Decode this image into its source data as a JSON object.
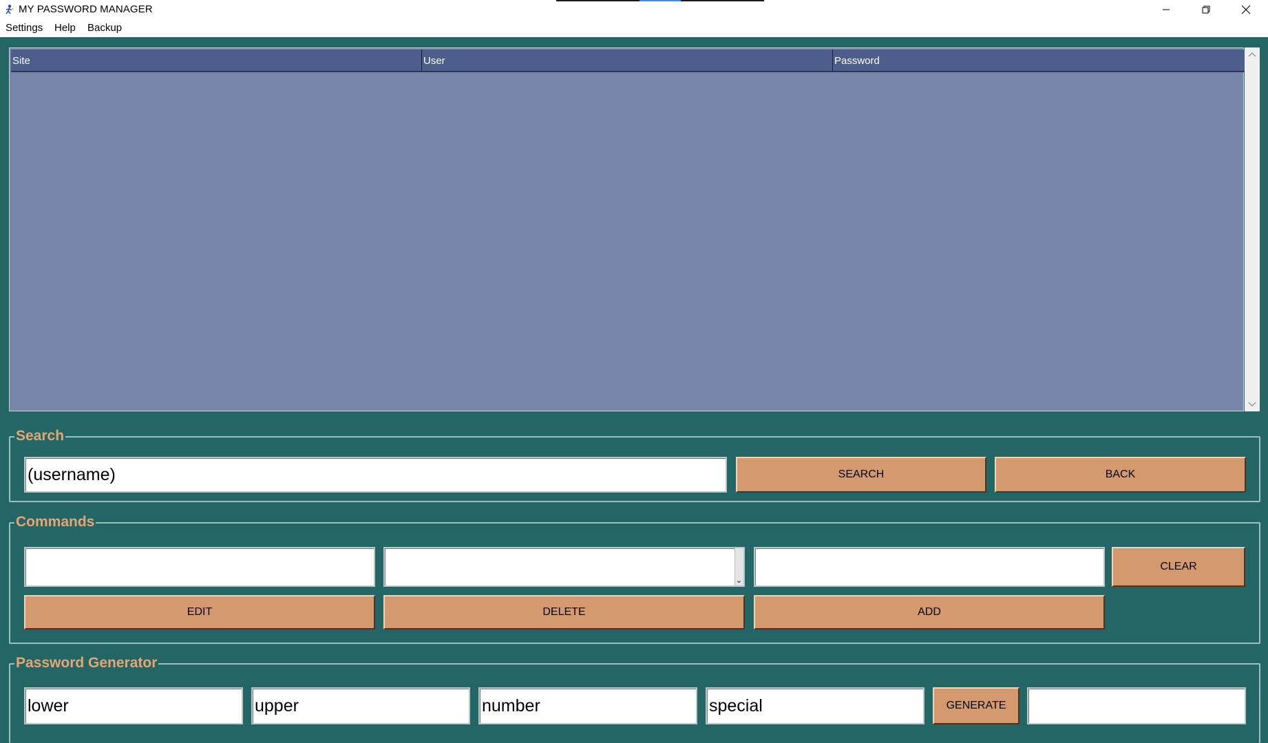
{
  "window": {
    "title": "MY PASSWORD MANAGER",
    "app_icon": "figure-icon",
    "controls": [
      "minimize-icon",
      "restore-icon",
      "close-icon"
    ]
  },
  "menu": {
    "items": [
      {
        "label": "Settings"
      },
      {
        "label": "Help"
      },
      {
        "label": "Backup"
      }
    ]
  },
  "table": {
    "columns": [
      "Site",
      "User",
      "Password"
    ],
    "rows": []
  },
  "search": {
    "legend": "Search",
    "input_value": "(username)",
    "search_label": "SEARCH",
    "back_label": "BACK"
  },
  "commands": {
    "legend": "Commands",
    "field1_value": "",
    "field2_value": "",
    "field3_value": "",
    "clear_label": "CLEAR",
    "edit_label": "EDIT",
    "delete_label": "DELETE",
    "add_label": "ADD"
  },
  "generator": {
    "legend": "Password Generator",
    "lower": "lower",
    "upper": "upper",
    "number": "number",
    "special": "special",
    "generate_label": "GENERATE",
    "output_value": ""
  },
  "colors": {
    "background": "#236665",
    "table_body": "#7886ab",
    "table_header": "#4d5e8c",
    "button": "#d4996d",
    "legend_text": "#e8a574"
  }
}
